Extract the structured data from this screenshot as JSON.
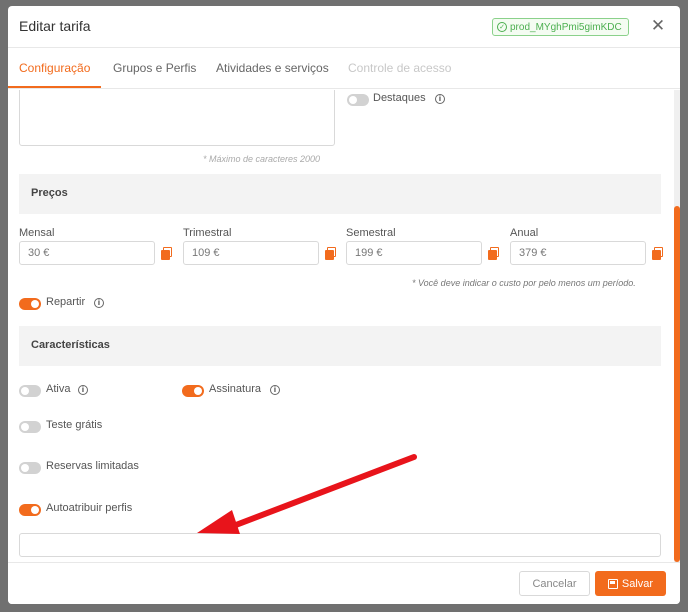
{
  "modal": {
    "title": "Editar tarifa",
    "product_id": "prod_MYghPmi5gimKDC"
  },
  "tabs": [
    {
      "label": "Configuração",
      "state": "active"
    },
    {
      "label": "Grupos e Perfis",
      "state": "normal"
    },
    {
      "label": "Atividades e serviços",
      "state": "normal"
    },
    {
      "label": "Controle de acesso",
      "state": "disabled"
    }
  ],
  "description": {
    "value": "",
    "hint": "* Máximo de caracteres 2000"
  },
  "highlights": {
    "label": "Destaques",
    "enabled": false
  },
  "prices": {
    "section_title": "Preços",
    "monthly": {
      "label": "Mensal",
      "value": "30 €"
    },
    "quarterly": {
      "label": "Trimestral",
      "value": "109 €"
    },
    "semiannual": {
      "label": "Semestral",
      "value": "199 €"
    },
    "annual": {
      "label": "Anual",
      "value": "379 €"
    },
    "hint": "* Você deve indicar o custo por pelo menos um período."
  },
  "split": {
    "label": "Repartir",
    "enabled": true
  },
  "features": {
    "section_title": "Características",
    "active": {
      "label": "Ativa",
      "enabled": false
    },
    "subscription": {
      "label": "Assinatura",
      "enabled": true
    },
    "free_trial": {
      "label": "Teste grátis",
      "enabled": false
    },
    "limited_bookings": {
      "label": "Reservas limitadas",
      "enabled": false
    },
    "auto_assign_profiles": {
      "label": "Autoatribuir perfis",
      "enabled": true
    },
    "profiles_value": ""
  },
  "footer": {
    "cancel_label": "Cancelar",
    "save_label": "Salvar"
  },
  "colors": {
    "accent": "#f26b1d",
    "badge_green": "#4caf50",
    "annotation_arrow": "#e8141b"
  },
  "icons": [
    "close-icon",
    "check-circle-icon",
    "info-icon",
    "copy-icon",
    "save-icon",
    "arrow-annotation"
  ]
}
